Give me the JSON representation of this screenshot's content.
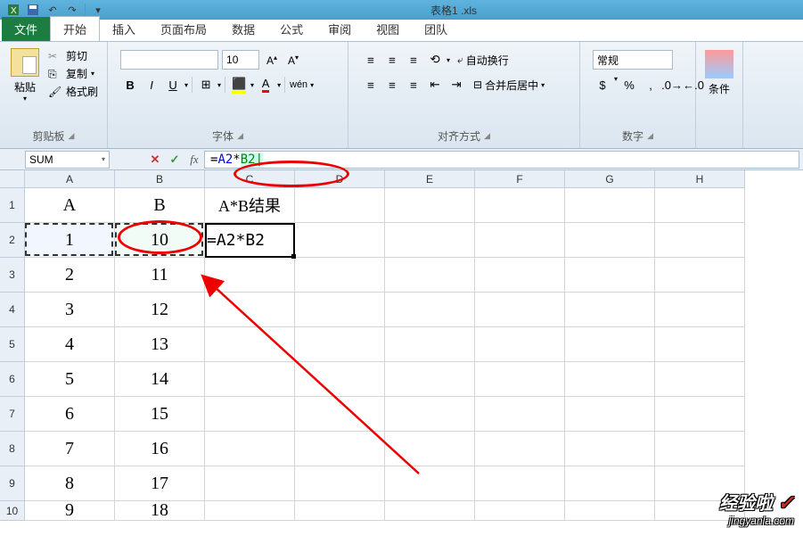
{
  "title": "表格1 .xls",
  "tabs": {
    "file": "文件",
    "home": "开始",
    "insert": "插入",
    "layout": "页面布局",
    "data": "数据",
    "formula": "公式",
    "review": "审阅",
    "view": "视图",
    "team": "团队"
  },
  "ribbon": {
    "clipboard": {
      "label": "剪贴板",
      "paste": "粘贴",
      "cut": "剪切",
      "copy": "复制",
      "format_painter": "格式刷"
    },
    "font": {
      "label": "字体",
      "family": "",
      "size": "10",
      "bold": "B",
      "italic": "I",
      "underline": "U"
    },
    "align": {
      "label": "对齐方式",
      "wrap": "自动换行",
      "merge": "合并后居中"
    },
    "number": {
      "label": "数字",
      "format": "常规"
    },
    "styles": {
      "cond": "条件"
    }
  },
  "formula_bar": {
    "name_box": "SUM",
    "formula_prefix": "=",
    "ref_a": "A2",
    "op": "*",
    "ref_b": "B2"
  },
  "columns": [
    "A",
    "B",
    "C",
    "D",
    "E",
    "F",
    "G",
    "H"
  ],
  "rows": [
    "1",
    "2",
    "3",
    "4",
    "5",
    "6",
    "7",
    "8",
    "9",
    "10"
  ],
  "grid": {
    "A1": "A",
    "B1": "B",
    "C1": "A*B结果",
    "A2": "1",
    "B2": "10",
    "C2": "=A2*B2",
    "A3": "2",
    "B3": "11",
    "A4": "3",
    "B4": "12",
    "A5": "4",
    "B5": "13",
    "A6": "5",
    "B6": "14",
    "A7": "6",
    "B7": "15",
    "A8": "7",
    "B8": "16",
    "A9": "8",
    "B9": "17",
    "A10": "9",
    "B10": "18"
  },
  "watermark": {
    "top": "经验啦",
    "check": "✓",
    "url": "jingyanla.com"
  }
}
